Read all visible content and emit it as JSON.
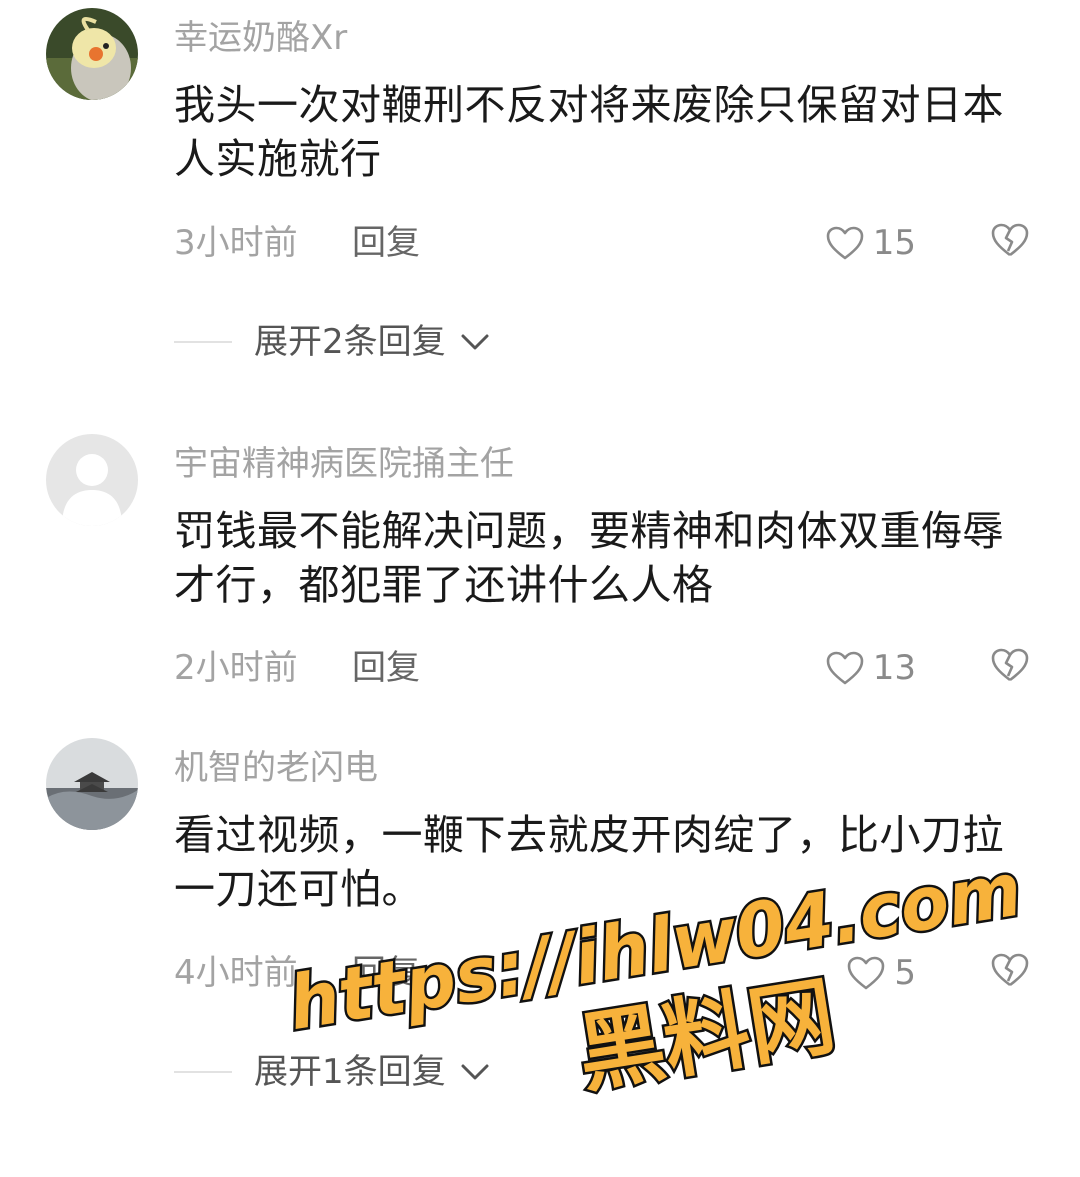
{
  "comments": [
    {
      "username": "幸运奶酪Xr",
      "text": "我头一次对鞭刑不反对将来废除只保留对日本人实施就行",
      "time": "3小时前",
      "reply_label": "回复",
      "likes": "15",
      "expand_label": "展开2条回复"
    },
    {
      "username": "宇宙精神病医院捅主任",
      "text": "罚钱最不能解决问题，要精神和肉体双重侮辱才行，都犯罪了还讲什么人格",
      "time": "2小时前",
      "reply_label": "回复",
      "likes": "13"
    },
    {
      "username": "机智的老闪电",
      "text": "看过视频，一鞭下去就皮开肉绽了，比小刀拉一刀还可怕。",
      "time": "4小时前",
      "reply_label": "回复",
      "likes": "5",
      "expand_label": "展开1条回复"
    }
  ],
  "watermark": {
    "url": "https://ihlw04.com",
    "name": "黑料网"
  },
  "colors": {
    "username": "#a3a3a3",
    "text": "#1a1a1a",
    "watermark_fill": "#f7b23b",
    "watermark_stroke": "#111111"
  }
}
